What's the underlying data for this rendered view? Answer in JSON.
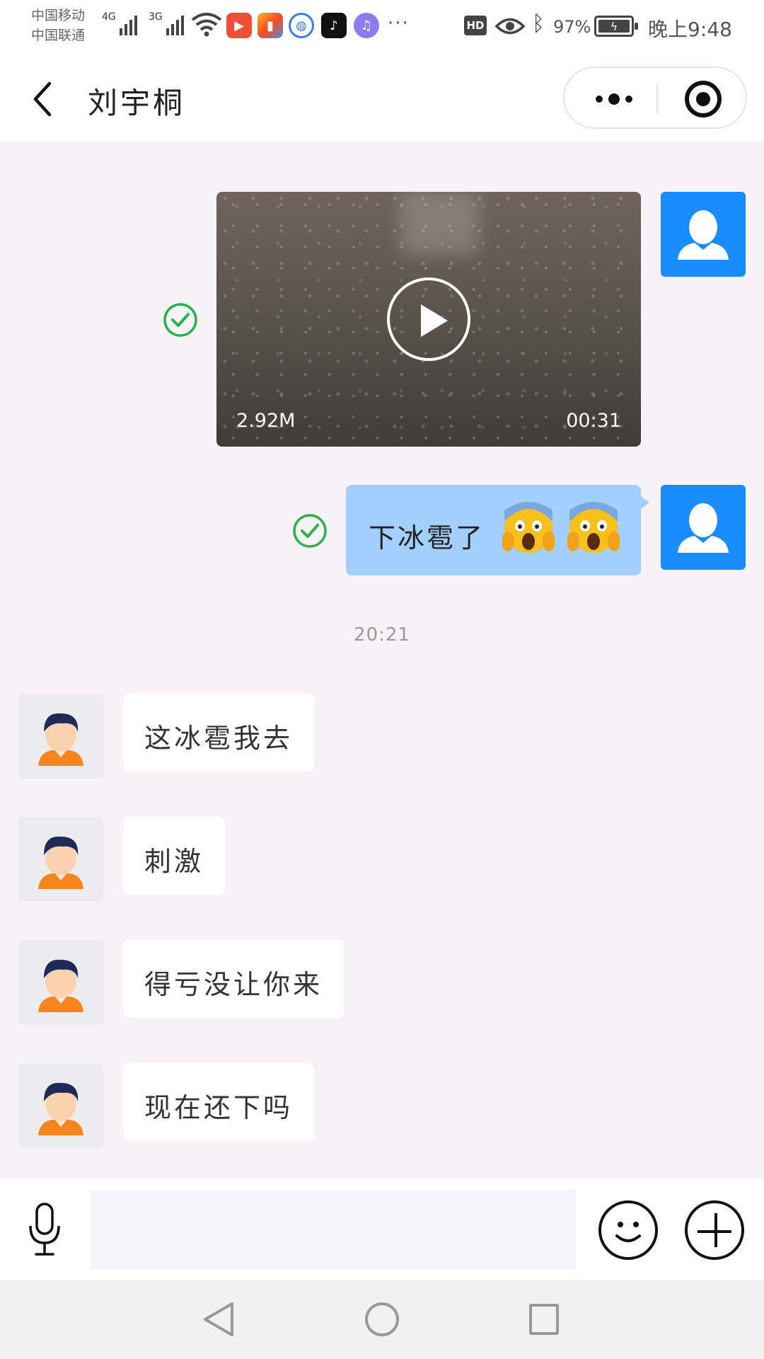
{
  "status_bar": {
    "carrier_1": "中国移动",
    "carrier_2": "中国联通",
    "network_1": "4G",
    "network_2": "3G",
    "hd_badge": "HD",
    "battery_percent": "97%",
    "time": "晚上9:48",
    "more_indicator": "···",
    "app_icons": [
      "kuaishou-icon",
      "paint-app-icon",
      "browser-icon",
      "tiktok-icon",
      "music-icon"
    ]
  },
  "header": {
    "title": "刘宇桐",
    "menu_icon": "more-dots-icon",
    "close_icon": "target-icon"
  },
  "messages": {
    "video": {
      "size": "2.92M",
      "duration": "00:31"
    },
    "sent_text": "下冰雹了",
    "timestamp": "20:21",
    "received": [
      {
        "text": "这冰雹我去"
      },
      {
        "text": "刺激"
      },
      {
        "text": "得亏没让你来"
      },
      {
        "text": "现在还下吗"
      }
    ]
  },
  "input_bar": {
    "placeholder": "",
    "value": ""
  },
  "colors": {
    "self_avatar": "#1a8cff",
    "self_bubble": "#a3cfff",
    "sent_check": "#2bb24c",
    "chat_background": "#f7f2f5"
  }
}
